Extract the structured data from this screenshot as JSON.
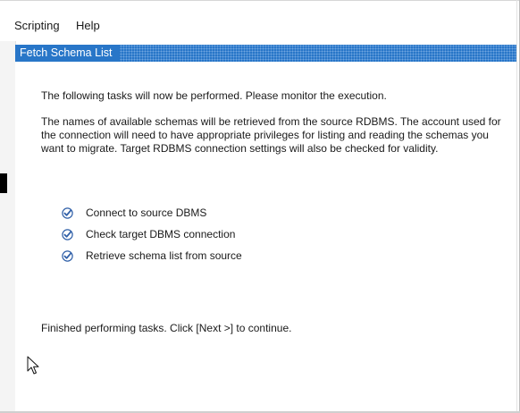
{
  "menu": {
    "items": [
      "Scripting",
      "Help"
    ]
  },
  "panel": {
    "title": "Fetch Schema List"
  },
  "content": {
    "intro": "The following tasks will now be performed. Please monitor the execution.",
    "description": "The names of available schemas will be retrieved from the source RDBMS. The account used for the connection will need to have appropriate privileges for listing and reading the schemas you want to migrate. Target RDBMS connection settings will also be checked for validity.",
    "tasks": [
      {
        "label": "Connect to source DBMS",
        "status": "done"
      },
      {
        "label": "Check target DBMS connection",
        "status": "done"
      },
      {
        "label": "Retrieve schema list from source",
        "status": "done"
      }
    ],
    "finish": "Finished performing tasks. Click [Next >] to continue."
  },
  "colors": {
    "header_blue": "#2876c8",
    "check_blue": "#2f5fa8"
  },
  "icons": {
    "task_done": "check-circle-icon",
    "pointer": "mouse-pointer-icon"
  }
}
